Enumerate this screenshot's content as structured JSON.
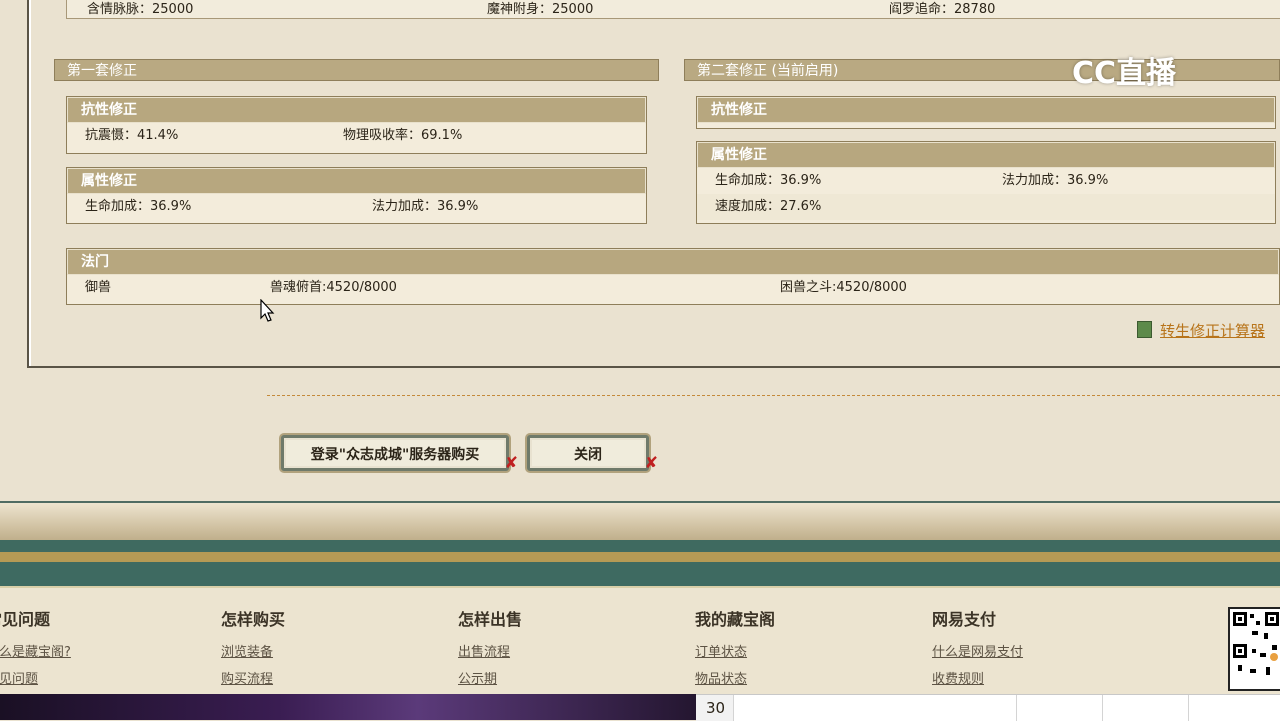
{
  "top_row": {
    "c1": "含情脉脉：25000",
    "c2": "魔神附身：25000",
    "c3": "阎罗追命：28780"
  },
  "watermark": "CC直播",
  "set1": {
    "title": "第一套修正",
    "resist": {
      "title": "抗性修正",
      "a": "抗震慑：41.4%",
      "b": "物理吸收率：69.1%"
    },
    "attr": {
      "title": "属性修正",
      "a": "生命加成：36.9%",
      "b": "法力加成：36.9%"
    }
  },
  "set2": {
    "title": "第二套修正 (当前启用)",
    "resist": {
      "title": "抗性修正"
    },
    "attr": {
      "title": "属性修正",
      "a": "生命加成：36.9%",
      "b": "法力加成：36.9%",
      "c": "速度加成：27.6%"
    }
  },
  "famen": {
    "title": "法门",
    "name": "御兽",
    "a": "兽魂俯首:4520/8000",
    "b": "困兽之斗:4520/8000"
  },
  "calculator_link": "转生修正计算器",
  "buttons": {
    "login": "登录\"众志成城\"服务器购买",
    "close": "关闭"
  },
  "footer": [
    {
      "title": "常见问题",
      "links": [
        "什么是藏宝阁?",
        "常见问题"
      ]
    },
    {
      "title": "怎样购买",
      "links": [
        "浏览装备",
        "购买流程"
      ]
    },
    {
      "title": "怎样出售",
      "links": [
        "出售流程",
        "公示期"
      ]
    },
    {
      "title": "我的藏宝阁",
      "links": [
        "订单状态",
        "物品状态"
      ]
    },
    {
      "title": "网易支付",
      "links": [
        "什么是网易支付",
        "收费规则"
      ]
    }
  ],
  "sheet_row": "30",
  "colors": {
    "header_bg": "#b7a77f",
    "teal": "#3e6a61",
    "link_orange": "#b8741a"
  }
}
